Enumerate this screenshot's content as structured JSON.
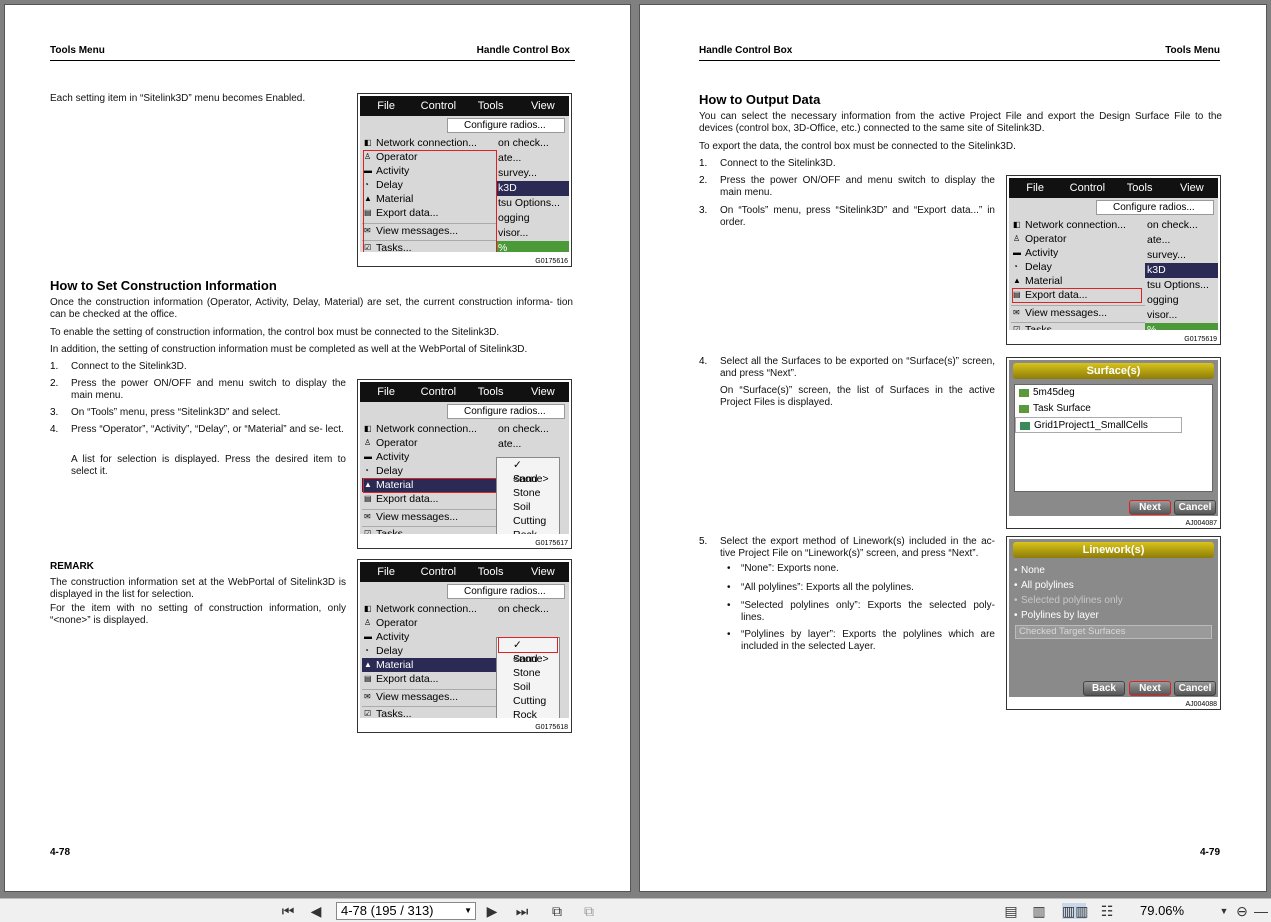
{
  "left_page": {
    "header_left": "Tools Menu",
    "header_right": "Handle Control Box",
    "intro": "Each setting item in “Sitelink3D” menu becomes Enabled.",
    "heading": "How to Set Construction Information",
    "para1": "Once the construction information (Operator, Activity, Delay, Material) are set, the current construction informa- tion can be checked at the office.",
    "para2": "To enable the setting of construction information, the control box must be connected to the Sitelink3D.",
    "para3": "In addition, the setting of construction information must be completed as well at the WebPortal of Sitelink3D.",
    "steps": [
      {
        "n": "1.",
        "text": "Connect to the Sitelink3D."
      },
      {
        "n": "2.",
        "text": "Press the power ON/OFF and menu switch to display the main menu."
      },
      {
        "n": "3.",
        "text": "On “Tools” menu, press “Sitelink3D” and select."
      },
      {
        "n": "4.",
        "text": "Press “Operator”, “Activity”, “Delay”, or “Material” and se- lect."
      }
    ],
    "step4_note": "A list for selection is displayed. Press the desired item to select it.",
    "remark_title": "REMARK",
    "remark1": "The construction information set at the WebPortal of Sitelink3D is displayed in the list for selection.",
    "remark2": "For the item with no setting of construction information, only “<none>” is displayed.",
    "page_number": "4-78"
  },
  "right_page": {
    "header_left": "Handle Control Box",
    "header_right": "Tools Menu",
    "heading": "How to Output Data",
    "para1": "You can select the necessary information from the active Project File and export the Design Surface File to the devices (control box, 3D-Office, etc.) connected to the same site of Sitelink3D.",
    "para2": "To export the data, the control box must be connected to the Sitelink3D.",
    "steps": [
      {
        "n": "1.",
        "text": "Connect to the Sitelink3D."
      },
      {
        "n": "2.",
        "text": "Press the power ON/OFF and menu switch to display the main menu."
      },
      {
        "n": "3.",
        "text": "On “Tools” menu, press “Sitelink3D” and “Export data...” in order."
      },
      {
        "n": "4.",
        "text": "Select all the Surfaces to be exported on “Surface(s)” screen, and press “Next”."
      },
      {
        "n": "5.",
        "text": "Select the export method of Linework(s) included in the ac- tive Project File on “Linework(s)” screen, and press “Next”."
      }
    ],
    "step4_note": "On “Surface(s)” screen, the list of Surfaces in the active Project Files is displayed.",
    "bullets": [
      "“None”: Exports none.",
      "“All polylines”: Exports all the polylines.",
      "“Selected polylines only”: Exports the selected poly- lines.",
      "“Polylines by layer”: Exports the polylines which are included in the selected Layer."
    ],
    "page_number": "4-79"
  },
  "device": {
    "menubar": [
      "File",
      "Control",
      "Tools",
      "View"
    ],
    "configure": "Configure radios...",
    "menu_items": [
      "Network connection...",
      "Operator",
      "Activity",
      "Delay",
      "Material",
      "Export data...",
      "View messages...",
      "Tasks..."
    ],
    "right_items": [
      "on check...",
      "ate...",
      "survey...",
      "k3D",
      "tsu Options...",
      "ogging",
      "visor...",
      "%"
    ],
    "submenu": [
      "✓ <none>",
      "Sand",
      "Stone",
      "Soil",
      "Cutting",
      "Rock"
    ],
    "codes": [
      "G0175616",
      "G0175617",
      "G0175618",
      "G0175619"
    ]
  },
  "surfaces_dialog": {
    "title": "Surface(s)",
    "items": [
      "5m45deg",
      "Task Surface",
      "Grid1Project1_SmallCells"
    ],
    "next": "Next",
    "cancel": "Cancel",
    "code": "AJ004087"
  },
  "linework_dialog": {
    "title": "Linework(s)",
    "options": [
      "None",
      "All polylines",
      "Selected polylines only",
      "Polylines by layer"
    ],
    "combo": "Checked Target Surfaces",
    "back": "Back",
    "next": "Next",
    "cancel": "Cancel",
    "code": "AJ004088"
  },
  "toolbar": {
    "page_field": "4-78 (195 / 313)",
    "zoom": "79.06%"
  }
}
